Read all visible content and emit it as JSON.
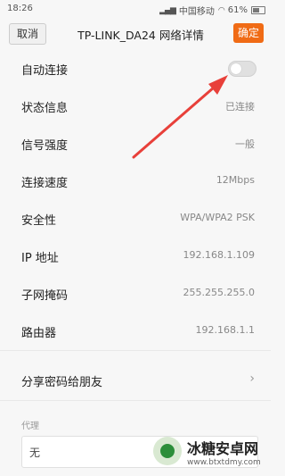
{
  "status_bar": {
    "time": "18:26",
    "carrier": "中国移动",
    "battery": "61%"
  },
  "header": {
    "cancel_label": "取消",
    "title": "TP-LINK_DA24 网络详情",
    "confirm_label": "确定"
  },
  "rows": [
    {
      "label": "自动连接",
      "value": ""
    },
    {
      "label": "状态信息",
      "value": "已连接"
    },
    {
      "label": "信号强度",
      "value": "一般"
    },
    {
      "label": "连接速度",
      "value": "12Mbps"
    },
    {
      "label": "安全性",
      "value": "WPA/WPA2 PSK"
    },
    {
      "label": "IP 地址",
      "value": "192.168.1.109"
    },
    {
      "label": "子网掩码",
      "value": "255.255.255.0"
    },
    {
      "label": "路由器",
      "value": "192.168.1.1"
    }
  ],
  "share": {
    "label": "分享密码给朋友"
  },
  "proxy": {
    "section_label": "代理",
    "value": "无"
  },
  "auto_connect_enabled": false,
  "colors": {
    "accent": "#f06b15",
    "arrow": "#e8403a"
  },
  "watermark": {
    "name": "冰糖安卓网",
    "url": "www.btxtdmy.com"
  }
}
